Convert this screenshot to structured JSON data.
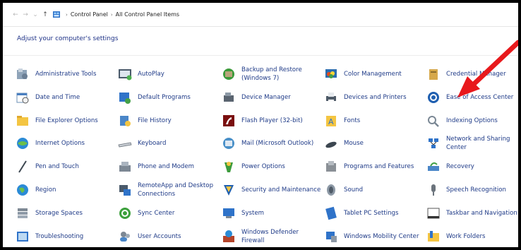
{
  "breadcrumb": {
    "items": [
      "Control Panel",
      "All Control Panel Items"
    ]
  },
  "header": {
    "subtitle": "Adjust your computer's settings"
  },
  "colors": {
    "link": "#1e3a87",
    "arrow": "#e8191c"
  },
  "items": [
    {
      "label": "Administrative Tools",
      "icon": "administrative-tools-icon",
      "col": 0,
      "row": 0
    },
    {
      "label": "AutoPlay",
      "icon": "autoplay-icon",
      "col": 1,
      "row": 0
    },
    {
      "label": "Backup and Restore\n(Windows 7)",
      "icon": "backup-restore-icon",
      "col": 2,
      "row": 0
    },
    {
      "label": "Color Management",
      "icon": "color-management-icon",
      "col": 3,
      "row": 0
    },
    {
      "label": "Credential Manager",
      "icon": "credential-manager-icon",
      "col": 4,
      "row": 0
    },
    {
      "label": "Date and Time",
      "icon": "date-time-icon",
      "col": 0,
      "row": 1
    },
    {
      "label": "Default Programs",
      "icon": "default-programs-icon",
      "col": 1,
      "row": 1
    },
    {
      "label": "Device Manager",
      "icon": "device-manager-icon",
      "col": 2,
      "row": 1
    },
    {
      "label": "Devices and Printers",
      "icon": "devices-printers-icon",
      "col": 3,
      "row": 1
    },
    {
      "label": "Ease of Access Center",
      "icon": "ease-of-access-icon",
      "col": 4,
      "row": 1
    },
    {
      "label": "File Explorer Options",
      "icon": "file-explorer-options-icon",
      "col": 0,
      "row": 2
    },
    {
      "label": "File History",
      "icon": "file-history-icon",
      "col": 1,
      "row": 2
    },
    {
      "label": "Flash Player (32-bit)",
      "icon": "flash-player-icon",
      "col": 2,
      "row": 2
    },
    {
      "label": "Fonts",
      "icon": "fonts-icon",
      "col": 3,
      "row": 2
    },
    {
      "label": "Indexing Options",
      "icon": "indexing-options-icon",
      "col": 4,
      "row": 2
    },
    {
      "label": "Internet Options",
      "icon": "internet-options-icon",
      "col": 0,
      "row": 3
    },
    {
      "label": "Keyboard",
      "icon": "keyboard-icon",
      "col": 1,
      "row": 3
    },
    {
      "label": "Mail (Microsoft Outlook)",
      "icon": "mail-icon",
      "col": 2,
      "row": 3
    },
    {
      "label": "Mouse",
      "icon": "mouse-icon",
      "col": 3,
      "row": 3
    },
    {
      "label": "Network and Sharing\nCenter",
      "icon": "network-sharing-icon",
      "col": 4,
      "row": 3
    },
    {
      "label": "Pen and Touch",
      "icon": "pen-touch-icon",
      "col": 0,
      "row": 4
    },
    {
      "label": "Phone and Modem",
      "icon": "phone-modem-icon",
      "col": 1,
      "row": 4
    },
    {
      "label": "Power Options",
      "icon": "power-options-icon",
      "col": 2,
      "row": 4
    },
    {
      "label": "Programs and Features",
      "icon": "programs-features-icon",
      "col": 3,
      "row": 4
    },
    {
      "label": "Recovery",
      "icon": "recovery-icon",
      "col": 4,
      "row": 4
    },
    {
      "label": "Region",
      "icon": "region-icon",
      "col": 0,
      "row": 5
    },
    {
      "label": "RemoteApp and Desktop\nConnections",
      "icon": "remoteapp-icon",
      "col": 1,
      "row": 5
    },
    {
      "label": "Security and Maintenance",
      "icon": "security-maintenance-icon",
      "col": 2,
      "row": 5
    },
    {
      "label": "Sound",
      "icon": "sound-icon",
      "col": 3,
      "row": 5
    },
    {
      "label": "Speech Recognition",
      "icon": "speech-recognition-icon",
      "col": 4,
      "row": 5
    },
    {
      "label": "Storage Spaces",
      "icon": "storage-spaces-icon",
      "col": 0,
      "row": 6
    },
    {
      "label": "Sync Center",
      "icon": "sync-center-icon",
      "col": 1,
      "row": 6
    },
    {
      "label": "System",
      "icon": "system-icon",
      "col": 2,
      "row": 6
    },
    {
      "label": "Tablet PC Settings",
      "icon": "tablet-pc-icon",
      "col": 3,
      "row": 6
    },
    {
      "label": "Taskbar and Navigation",
      "icon": "taskbar-navigation-icon",
      "col": 4,
      "row": 6
    },
    {
      "label": "Troubleshooting",
      "icon": "troubleshooting-icon",
      "col": 0,
      "row": 7
    },
    {
      "label": "User Accounts",
      "icon": "user-accounts-icon",
      "col": 1,
      "row": 7
    },
    {
      "label": "Windows Defender\nFirewall",
      "icon": "windows-defender-icon",
      "col": 2,
      "row": 7
    },
    {
      "label": "Windows Mobility Center",
      "icon": "windows-mobility-icon",
      "col": 3,
      "row": 7
    },
    {
      "label": "Work Folders",
      "icon": "work-folders-icon",
      "col": 4,
      "row": 7
    }
  ]
}
